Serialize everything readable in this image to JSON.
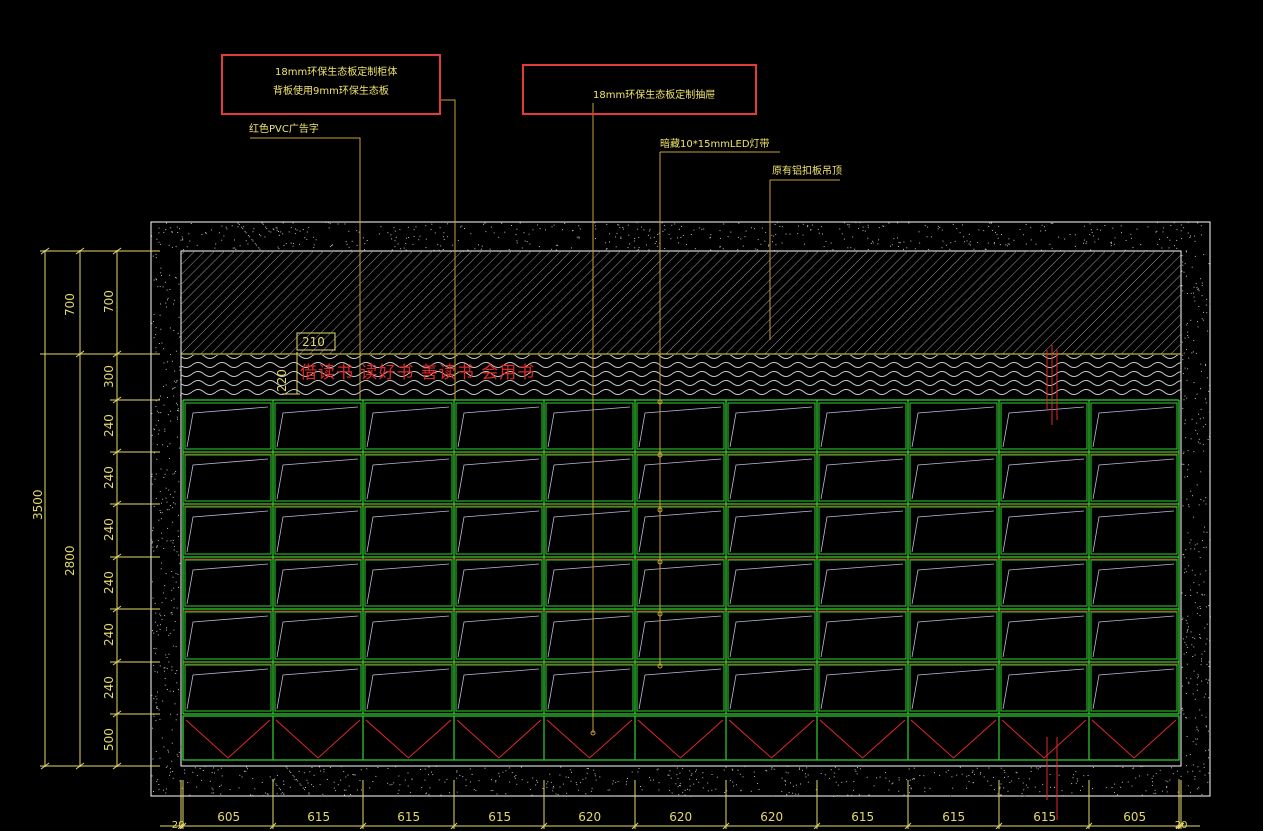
{
  "annotations": {
    "cabinet_body": "18mm环保生态板定制柜体",
    "back_panel": "背板使用9mm环保生态板",
    "drawer": "18mm环保生态板定制抽屉",
    "sign_text": "红色PVC广告字",
    "led": "暗藏10*15mmLED灯带",
    "ceiling": "原有铝扣板吊顶"
  },
  "sign_label": "借读书  读好书  善读书  会用书",
  "small_dims": {
    "w": "210",
    "h": "220"
  },
  "left_dims_outer": {
    "total": "3500"
  },
  "left_dims_mid": {
    "top": "700",
    "body": "2800"
  },
  "left_dims_inner": [
    "700",
    "300",
    "240",
    "240",
    "240",
    "240",
    "240",
    "240",
    "500"
  ],
  "bottom_dims": [
    "20",
    "605",
    "615",
    "615",
    "615",
    "620",
    "620",
    "620",
    "615",
    "615",
    "615",
    "605",
    "20"
  ],
  "colors": {
    "background": "#000000",
    "wall": "#ffffff",
    "shelf": "#2fd42f",
    "shelf_divider": "#e02828",
    "leader": "#c9a13a",
    "text": "#f1e56a",
    "note_box": "#e23b3b"
  },
  "grid": {
    "rows": 6,
    "cols": 11
  }
}
